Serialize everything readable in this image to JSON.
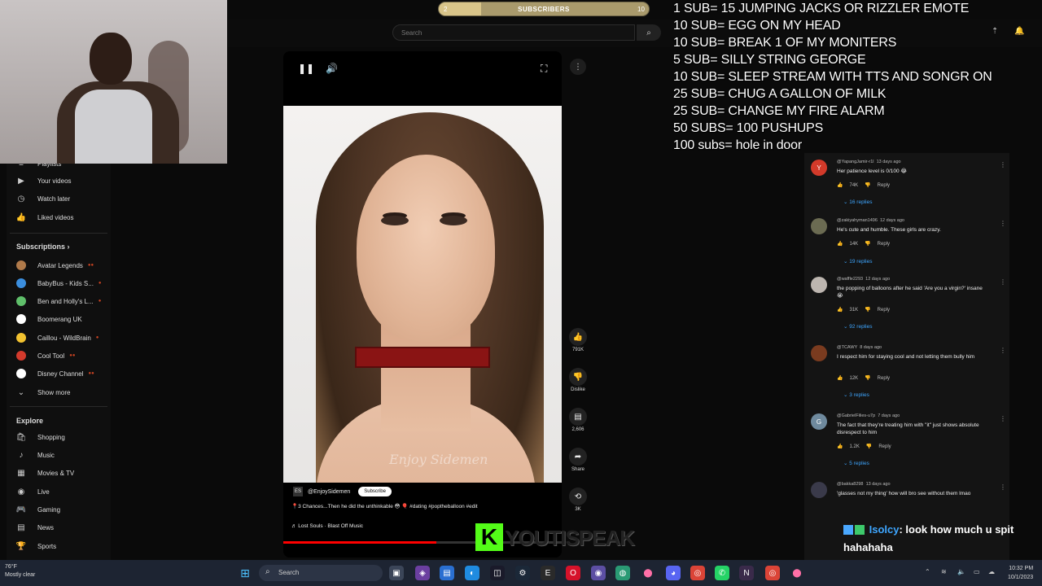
{
  "youtube": {
    "search_placeholder": "Search",
    "sidebar": {
      "top_items": [
        {
          "label": "Playlists",
          "icon": "playlist-icon"
        },
        {
          "label": "Your videos",
          "icon": "video-icon"
        },
        {
          "label": "Watch later",
          "icon": "clock-icon"
        },
        {
          "label": "Liked videos",
          "icon": "thumbs-up-icon"
        }
      ],
      "subscriptions_header": "Subscriptions",
      "subscriptions": [
        {
          "label": "Avatar Legends",
          "color": "#b07a4a"
        },
        {
          "label": "BabyBus - Kids S...",
          "color": "#3b8ede"
        },
        {
          "label": "Ben and Holly's L...",
          "color": "#5fbf6a"
        },
        {
          "label": "Boomerang UK",
          "color": "#ffffff"
        },
        {
          "label": "Caillou - WildBrain",
          "color": "#f2c230"
        },
        {
          "label": "Cool Tool",
          "color": "#d33a2c"
        },
        {
          "label": "Disney Channel",
          "color": "#ffffff"
        }
      ],
      "show_more": "Show more",
      "explore_header": "Explore",
      "explore": [
        {
          "label": "Shopping",
          "icon": "bag-icon"
        },
        {
          "label": "Music",
          "icon": "music-icon"
        },
        {
          "label": "Movies & TV",
          "icon": "film-icon"
        },
        {
          "label": "Live",
          "icon": "live-icon"
        },
        {
          "label": "Gaming",
          "icon": "gamepad-icon"
        },
        {
          "label": "News",
          "icon": "news-icon"
        },
        {
          "label": "Sports",
          "icon": "trophy-icon"
        }
      ]
    },
    "short": {
      "channel": "@EnjoySidemen",
      "channel_logo": "ES",
      "subscribe": "Subscribe",
      "caption": "📍3 Chances...Then he did the unthinkable 😳 🎈 #dating #poptheballoon #edit",
      "music": "♬ Lost Souls · Blast Off Music",
      "watermark": "Enjoy Sidemen",
      "progress_fraction": 0.55,
      "likes": "791K",
      "dislike": "Dislike",
      "comments": "2,606",
      "share": "Share",
      "remix": "3K"
    },
    "comments": [
      {
        "user": "@YapangJamir-r1l",
        "age": "13 days ago",
        "text": "Her patience level is 0/100 😂",
        "likes": "74K",
        "replies": "16 replies",
        "avatar_letter": "Y",
        "avatar_color": "#d23a2a"
      },
      {
        "user": "@zakiyahyman1496",
        "age": "12 days ago",
        "text": "He's cute and humble. These girls are crazy.",
        "likes": "14K",
        "replies": "19 replies",
        "avatar_letter": "",
        "avatar_color": "#6b6b52"
      },
      {
        "user": "@waffle2293",
        "age": "12 days ago",
        "text": "the popping of balloons after he said 'Are you a virgin?' insane 😭",
        "likes": "31K",
        "replies": "92 replies",
        "avatar_letter": "",
        "avatar_color": "#bdb6b0"
      },
      {
        "user": "@TCAWY",
        "age": "8 days ago",
        "text": "I respect him for staying cool and not letting them bully him",
        "likes": "12K",
        "replies": "3 replies",
        "avatar_letter": "",
        "avatar_color": "#7a3b1f"
      },
      {
        "user": "@GabrielFilies-u7p",
        "age": "7 days ago",
        "text": "The fact that they're treating him with \"it\" just shows absolute disrespect to him",
        "likes": "1.2K",
        "replies": "5 replies",
        "avatar_letter": "G",
        "avatar_color": "#6f8a9e"
      },
      {
        "user": "@bakka8298",
        "age": "13 days ago",
        "text": "'glasses not my thing' how will bro see without them lmao",
        "likes": "",
        "replies": "",
        "avatar_letter": "",
        "avatar_color": "#3a3a4a"
      }
    ],
    "reply_label": "Reply"
  },
  "stream": {
    "sub_goal": {
      "label": "SUBSCRIBERS",
      "current": "2",
      "target": "10",
      "fraction": 0.2
    },
    "goals": [
      "1 SUB= 15 JUMPING JACKS OR RIZZLER EMOTE",
      "10 SUB= EGG ON MY HEAD",
      "10 SUB= BREAK 1 OF MY MONITERS",
      "5 SUB= SILLY STRING GEORGE",
      "10 SUB= SLEEP STREAM WITH TTS AND SONGR ON",
      "25 SUB= CHUG A GALLON OF MILK",
      "25 SUB= CHANGE MY FIRE ALARM",
      "50 SUBS= 100 PUSHUPS",
      "100 subs= hole in door"
    ],
    "chat": {
      "user": "Isolcy",
      "message": ": look how much u spit hahahaha"
    },
    "kick_letter": "K",
    "kick_name": "YOUTISPEAK"
  },
  "taskbar": {
    "weather_temp": "76°F",
    "weather_desc": "Mostly clear",
    "search_placeholder": "Search",
    "time": "10:32 PM",
    "date": "10/1/2023"
  }
}
